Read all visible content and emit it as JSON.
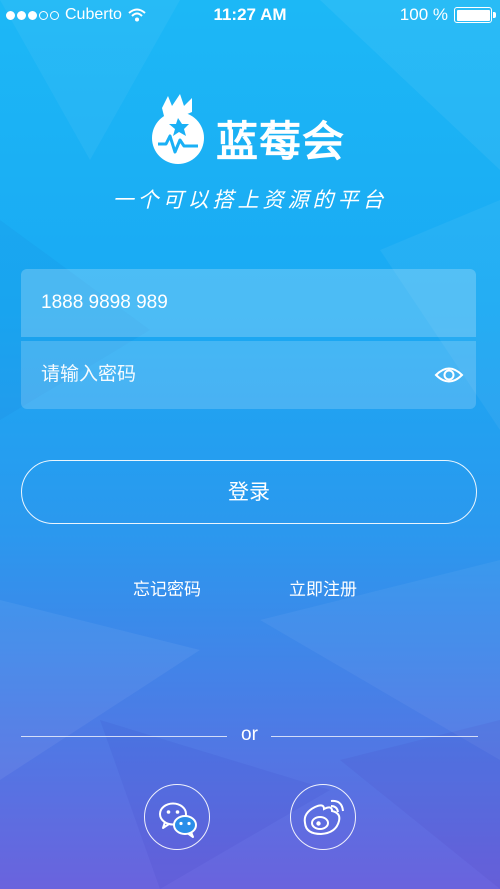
{
  "status": {
    "carrier": "Cuberto",
    "time": "11:27 AM",
    "battery": "100 %"
  },
  "brand": {
    "name": "蓝莓会",
    "slogan": "一个可以搭上资源的平台"
  },
  "form": {
    "phone_value": "1888 9898 989",
    "password_placeholder": "请输入密码"
  },
  "actions": {
    "login_label": "登录",
    "forgot_label": "忘记密码",
    "register_label": "立即注册",
    "divider_label": "or"
  },
  "icons": {
    "wechat": "wechat-icon",
    "weibo": "weibo-icon",
    "eye": "eye-icon",
    "wifi": "wifi-icon",
    "battery": "battery-icon"
  }
}
